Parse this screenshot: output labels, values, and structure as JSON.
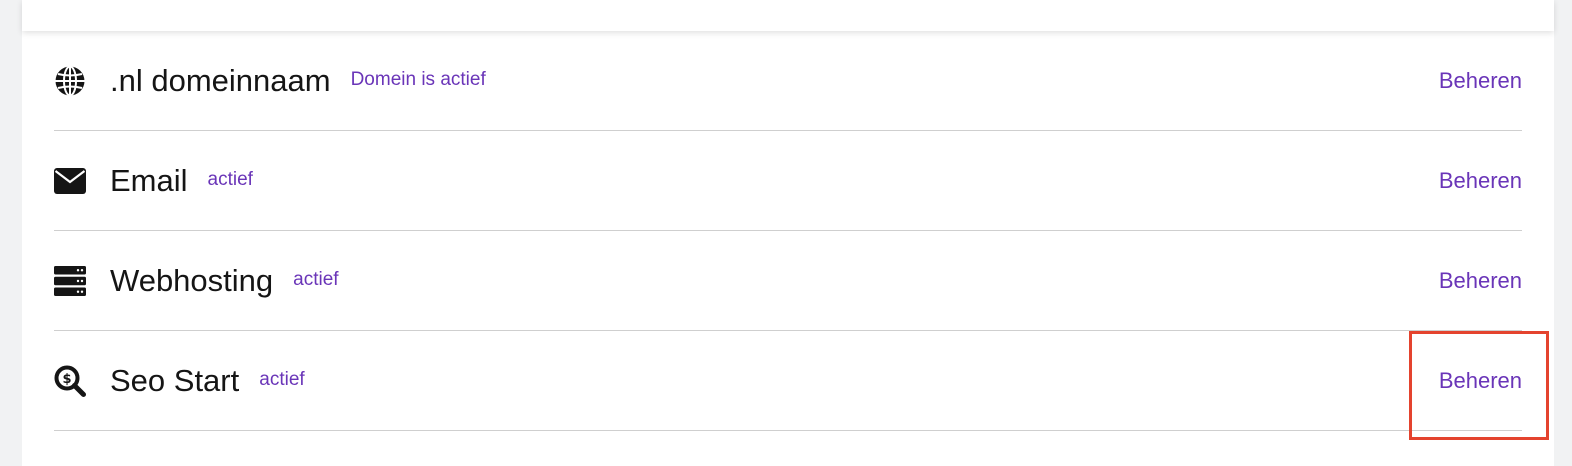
{
  "services": [
    {
      "icon": "globe-icon",
      "name": ".nl domeinnaam",
      "status": "Domein is actief",
      "action": "Beheren"
    },
    {
      "icon": "envelope-icon",
      "name": "Email",
      "status": "actief",
      "action": "Beheren"
    },
    {
      "icon": "server-icon",
      "name": "Webhosting",
      "status": "actief",
      "action": "Beheren"
    },
    {
      "icon": "seo-search-dollar-icon",
      "name": "Seo Start",
      "status": "actief",
      "action": "Beheren"
    }
  ],
  "colors": {
    "accent": "#6a35b8",
    "text": "#151515",
    "highlight": "#e4432e",
    "divider": "#cfcfcf",
    "background": "#f1f2f3"
  }
}
